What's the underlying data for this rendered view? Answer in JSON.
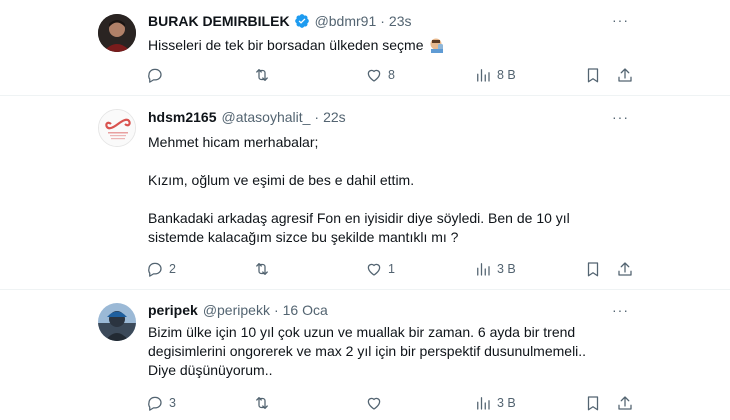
{
  "colors": {
    "text": "#0f1419",
    "muted": "#536471",
    "verified": "#1d9bf0",
    "divider": "#eff3f4"
  },
  "tweets": [
    {
      "name": "BURAK DEMIRBILEK",
      "verified": true,
      "handle": "@bdmr91",
      "separator": "·",
      "time": "23s",
      "text": "Hisseleri de tek bir borsadan ülkeden seçme",
      "emoji": "facepalm-emoji",
      "more": "···",
      "replies": "",
      "retweets": "",
      "likes": "8",
      "views": "8 B"
    },
    {
      "name": "hdsm2165",
      "handle": "@atasoyhalit_",
      "separator": "·",
      "time": "22s",
      "text": "Mehmet hicam merhabalar;\n\nKızım, oğlum ve eşimi de bes e dahil ettim.\n\nBankadaki arkadaş agresif Fon en iyisidir diye söyledi. Ben de 10 yıl sistemde kalacağım sizce bu şekilde mantıklı mı ?",
      "more": "···",
      "replies": "2",
      "retweets": "",
      "likes": "1",
      "views": "3 B"
    },
    {
      "name": "peripek",
      "handle": "@peripekk",
      "separator": "·",
      "time": "16 Oca",
      "text": "Bizim ülke için 10 yıl çok uzun ve muallak bir zaman. 6 ayda bir trend degisimlerini ongorerek ve max 2 yıl için bir perspektif dusunulmemeli..\nDiye düşünüyorum..",
      "more": "···",
      "replies": "3",
      "retweets": "",
      "likes": "",
      "views": "3 B"
    }
  ]
}
